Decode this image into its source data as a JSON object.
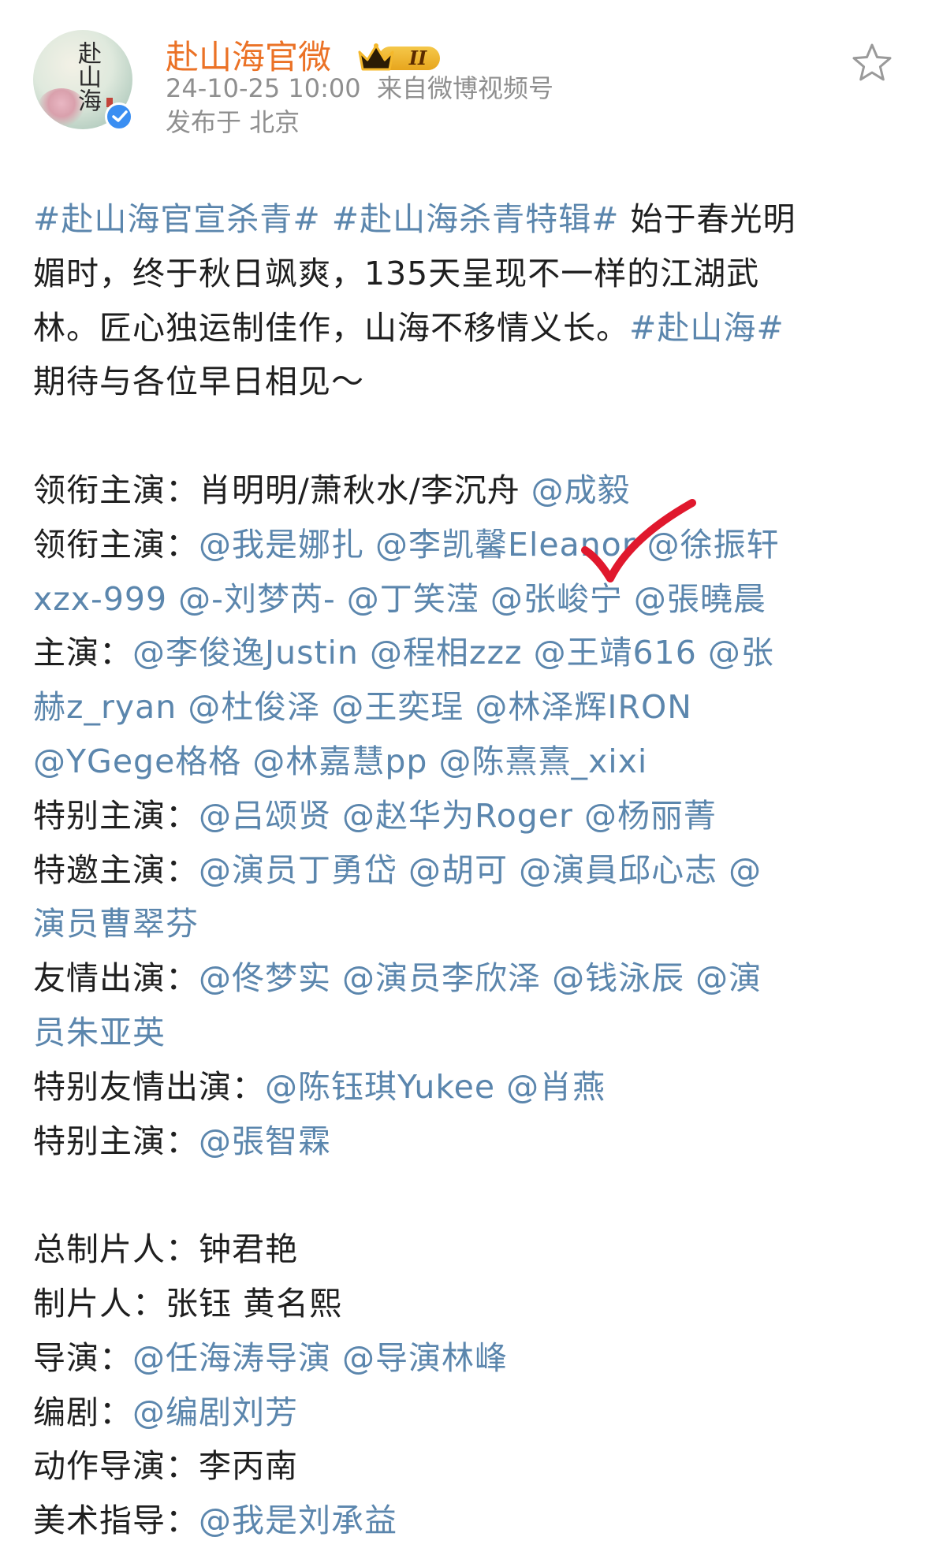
{
  "post": {
    "author": "赴山海官微",
    "author_badge_level": "II",
    "timestamp": "24-10-25 10:00",
    "source": "来自微博视频号",
    "location": "发布于 北京",
    "avatar_text": "赴山海",
    "icons": {
      "avatar": "avatar-image",
      "verified": "verified-icon",
      "badge": "crown-badge-icon",
      "favorite": "star-icon",
      "annotation": "checkmark-icon"
    }
  },
  "colors": {
    "username": "#eb7226",
    "link": "#5b86ad",
    "text": "#1f1f1f",
    "meta": "#8f8f8f",
    "verified": "#3a8ef2",
    "checkmark": "#e0182d"
  },
  "body": {
    "intro": {
      "hashtag1": "#赴山海官宣杀青#",
      "hashtag2": "#赴山海杀青特辑#",
      "text1": " 始于春光明",
      "text2": "媚时，终于秋日飒爽，135天呈现不一样的江湖武",
      "text3": "林。匠心独运制佳作，山海不移情义长。",
      "hashtag3": "#赴山海#",
      "text4": "期待与各位早日相见～"
    },
    "cast": {
      "lead1_label": "领衔主演：",
      "lead1_text": "肖明明/萧秋水/李沉舟 ",
      "lead1_m1": "@成毅",
      "lead2_label": "领衔主演：",
      "lead2_m1": "@我是娜扎",
      "lead2_m2": "@李凯馨Eleanor",
      "lead2_m3": "@徐振轩",
      "lead2_m4": "xzx-999",
      "lead2_m5": "@-刘梦芮-",
      "lead2_m6": "@丁笑滢",
      "lead2_m7": "@张峻宁",
      "lead2_m8": "@張曉晨",
      "main_label": "主演：",
      "main_m1": "@李俊逸Justin",
      "main_m2": "@程相zzz",
      "main_m3": "@王靖616",
      "main_m4": "@张",
      "main_m5": "赫z_ryan",
      "main_m6": "@杜俊泽",
      "main_m7": "@王奕珵",
      "main_m8": "@林泽辉IRON",
      "main_m9": "@YGege格格",
      "main_m10": "@林嘉慧pp",
      "main_m11": "@陈熹熹_xixi",
      "special_label": "特别主演：",
      "special_m1": "@吕颂贤",
      "special_m2": "@赵华为Roger",
      "special_m3": "@杨丽菁",
      "invited_label": "特邀主演：",
      "invited_m1": "@演员丁勇岱",
      "invited_m2": "@胡可",
      "invited_m3": "@演員邱心志",
      "invited_m4": "@",
      "invited_m5": "演员曹翠芬",
      "friend_label": "友情出演：",
      "friend_m1": "@佟梦实",
      "friend_m2": "@演员李欣泽",
      "friend_m3": "@钱泳辰",
      "friend_m4": "@演",
      "friend_m5": "员朱亚英",
      "special_friend_label": "特别友情出演：",
      "special_friend_m1": "@陈钰琪Yukee",
      "special_friend_m2": "@肖燕",
      "special2_label": "特别主演：",
      "special2_m1": "@張智霖"
    },
    "crew": {
      "chief_producer_label": "总制片人：",
      "chief_producer": "钟君艳",
      "producer_label": "制片人：",
      "producer": "张钰 黄名熙",
      "director_label": "导演：",
      "director_m1": "@任海涛导演",
      "director_m2": "@导演林峰",
      "writer_label": "编剧：",
      "writer_m1": "@编剧刘芳",
      "action_label": "动作导演：",
      "action": "李丙南",
      "art_label": "美术指导：",
      "art_m1": "@我是刘承益"
    }
  }
}
